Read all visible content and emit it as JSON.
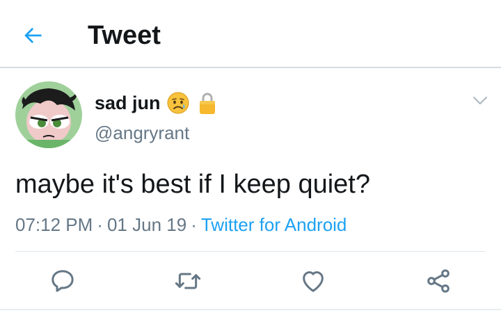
{
  "header": {
    "title": "Tweet",
    "back_icon": "arrow-left-icon"
  },
  "tweet": {
    "author": {
      "display_name": "sad jun",
      "name_emoji": "sad-but-relieved-face-emoji",
      "protected_icon": "lock-icon",
      "handle": "@angryrant"
    },
    "text": "maybe it's best if I keep quiet?",
    "time": "07:12 PM",
    "date": "01 Jun 19",
    "separator": "·",
    "source": "Twitter for Android",
    "menu_icon": "chevron-down-icon"
  },
  "actions": [
    {
      "name": "reply",
      "icon": "reply-icon"
    },
    {
      "name": "retweet",
      "icon": "retweet-icon"
    },
    {
      "name": "like",
      "icon": "heart-icon"
    },
    {
      "name": "share",
      "icon": "share-icon"
    }
  ],
  "colors": {
    "accent": "#1da1f2",
    "text_primary": "#14171a",
    "text_secondary": "#657786",
    "icon_gray": "#657786"
  }
}
